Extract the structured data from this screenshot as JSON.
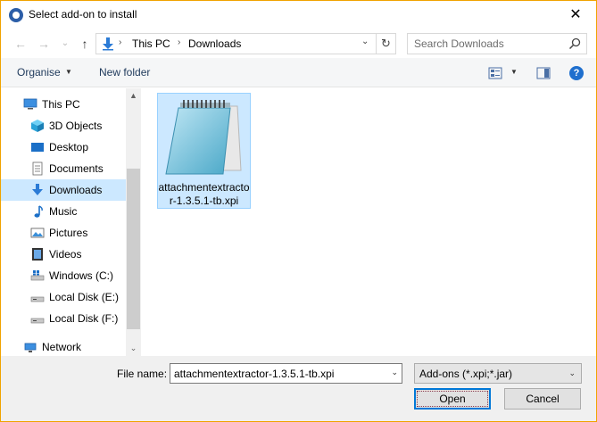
{
  "window": {
    "title": "Select add-on to install",
    "close_glyph": "✕",
    "icon": "thunderbird-icon"
  },
  "nav": {
    "back_glyph": "←",
    "forward_glyph": "→",
    "recent_glyph": "⌄",
    "up_glyph": "↑"
  },
  "address": {
    "segments": [
      "This PC",
      "Downloads"
    ],
    "separator": "›",
    "dropdown_glyph": "⌄",
    "refresh_glyph": "↻"
  },
  "search": {
    "placeholder": "Search Downloads"
  },
  "toolbar": {
    "organise_label": "Organise",
    "organise_dd": "▼",
    "new_folder_label": "New folder",
    "view_dd": "▼",
    "help_glyph": "?"
  },
  "sidebar": {
    "items": [
      {
        "label": "This PC",
        "icon": "computer-icon",
        "selected": false
      },
      {
        "label": "3D Objects",
        "icon": "cube-icon",
        "selected": false
      },
      {
        "label": "Desktop",
        "icon": "desktop-icon",
        "selected": false
      },
      {
        "label": "Documents",
        "icon": "documents-icon",
        "selected": false
      },
      {
        "label": "Downloads",
        "icon": "download-icon",
        "selected": true
      },
      {
        "label": "Music",
        "icon": "music-icon",
        "selected": false
      },
      {
        "label": "Pictures",
        "icon": "pictures-icon",
        "selected": false
      },
      {
        "label": "Videos",
        "icon": "videos-icon",
        "selected": false
      },
      {
        "label": "Windows (C:)",
        "icon": "windows-drive-icon",
        "selected": false
      },
      {
        "label": "Local Disk (E:)",
        "icon": "drive-icon",
        "selected": false
      },
      {
        "label": "Local Disk (F:)",
        "icon": "drive-icon",
        "selected": false
      },
      {
        "label": "Network",
        "icon": "network-icon",
        "selected": false
      }
    ],
    "scroll_up": "▲",
    "scroll_down": "⌄"
  },
  "files": [
    {
      "name": "attachmentextractor-1.3.5.1-tb.xpi",
      "icon": "notepad-icon",
      "selected": true
    }
  ],
  "bottom": {
    "file_name_label": "File name:",
    "file_name_value": "attachmentextractor-1.3.5.1-tb.xpi",
    "file_name_dd": "⌄",
    "file_type_value": "Add-ons (*.xpi;*.jar)",
    "file_type_dd": "⌄",
    "open_label": "Open",
    "cancel_label": "Cancel"
  },
  "colors": {
    "window_border": "#f0a300",
    "selection": "#cce8ff",
    "accent": "#0078d7",
    "link_text": "#1e395b"
  }
}
